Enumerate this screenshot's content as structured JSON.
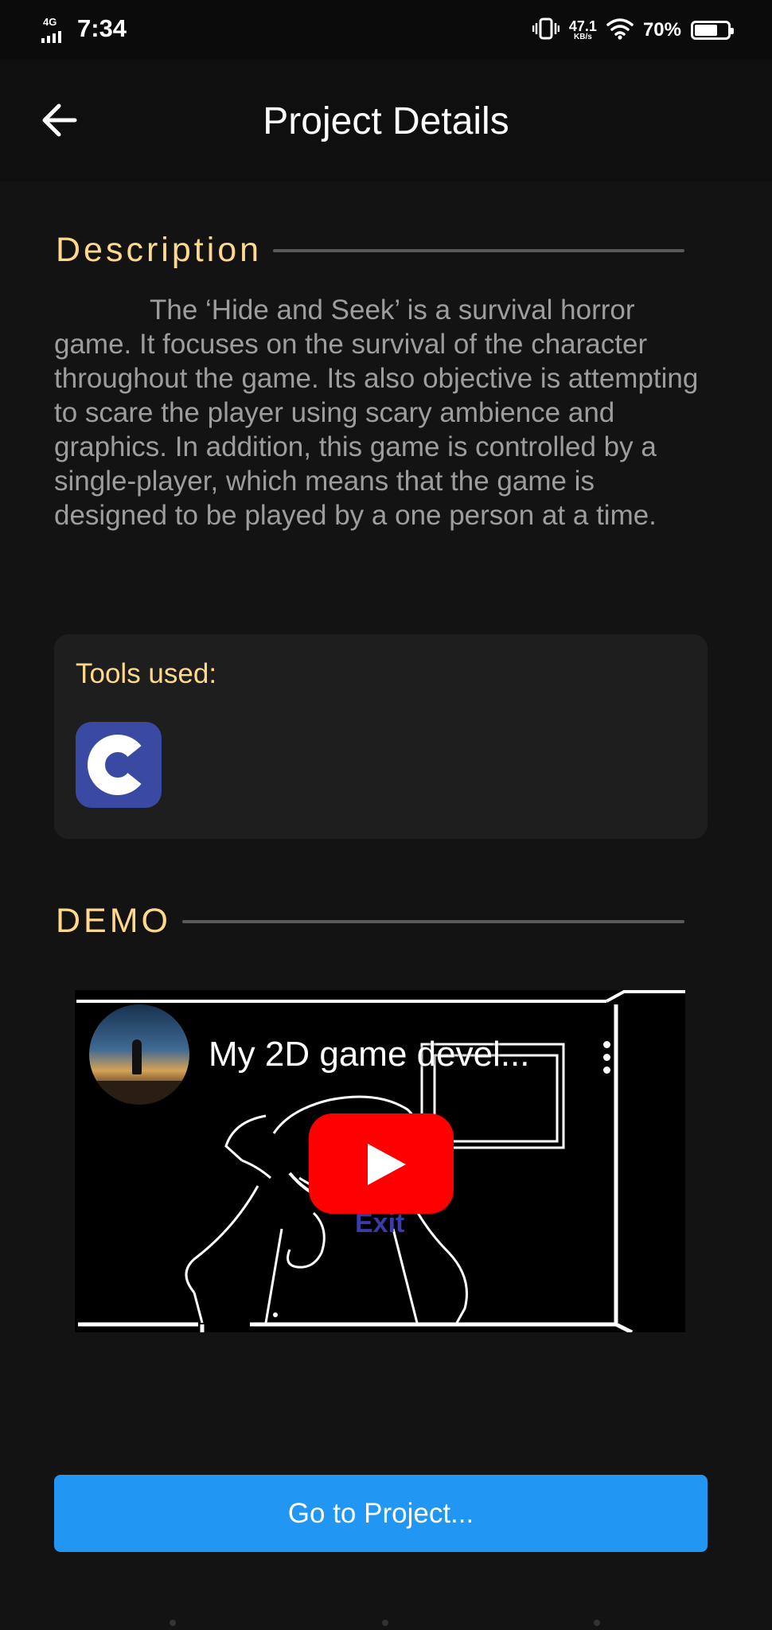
{
  "status_bar": {
    "network": "4G",
    "time": "7:34",
    "speed_value": "47.1",
    "speed_unit": "KB/s",
    "battery": "70%",
    "battery_level": 0.7,
    "icons": [
      "signal-icon",
      "vibrate-icon",
      "wifi-icon",
      "battery-icon"
    ]
  },
  "app_bar": {
    "title": "Project Details",
    "back_icon": "arrow-left-icon"
  },
  "description": {
    "heading": "Description",
    "text": "The ‘Hide and Seek’ is a survival horror game. It focuses on the survival of the character throughout the game. Its also objective is attempting to scare the player using scary ambience and graphics. In addition, this game is controlled by a single-player, which means that the game is designed to be played by a one person at a time."
  },
  "tools": {
    "label": "Tools used:",
    "items": [
      {
        "icon": "c-language-icon",
        "color": "#3a4aa3"
      }
    ]
  },
  "demo": {
    "heading": "DEMO",
    "video_title": "My 2D game devel...",
    "video_overlay_text": "Exit",
    "play_icon": "youtube-play-icon",
    "menu_icon": "kebab-menu-icon"
  },
  "action": {
    "button_label": "Go to Project..."
  },
  "colors": {
    "background": "#131313",
    "accent": "#ffd98a",
    "button": "#2196f3",
    "youtube_red": "#ff0000"
  }
}
